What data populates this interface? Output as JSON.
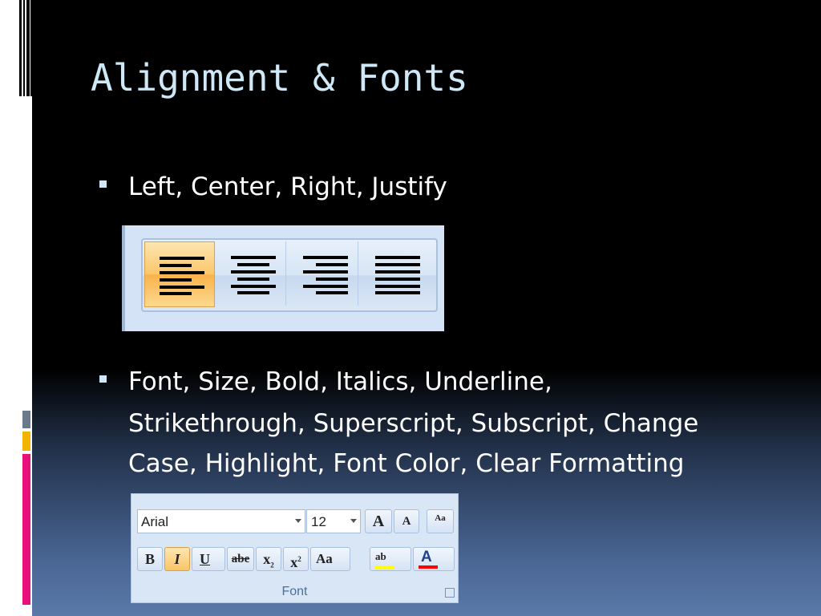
{
  "slide": {
    "title": "Alignment & Fonts",
    "bullets": [
      "Left, Center, Right, Justify",
      "Font, Size, Bold, Italics, Underline,",
      "Strikethrough, Superscript, Subscript, Change",
      "Case, Highlight, Font Color, Clear Formatting"
    ]
  },
  "alignment_toolbar": {
    "buttons": [
      {
        "name": "align-left",
        "icon": "align-left-icon",
        "active": true
      },
      {
        "name": "align-center",
        "icon": "align-center-icon",
        "active": false
      },
      {
        "name": "align-right",
        "icon": "align-right-icon",
        "active": false
      },
      {
        "name": "justify",
        "icon": "justify-icon",
        "active": false
      }
    ]
  },
  "font_group": {
    "font_name": "Arial",
    "font_size": "12",
    "grow_font": "A",
    "shrink_font": "A",
    "clear_formatting": "Aa",
    "bold": "B",
    "italic": "I",
    "underline": "U",
    "strikethrough": "abe",
    "subscript": "x",
    "subscript_mark": "2",
    "superscript": "x",
    "superscript_mark": "2",
    "change_case": "Aa",
    "highlight": "ab",
    "font_color": "A",
    "label": "Font"
  },
  "colors": {
    "title": "#cfe8f7",
    "active_button": "#f9b24a",
    "highlight_bar": "#ffff00",
    "font_color_bar": "#ff0000"
  }
}
